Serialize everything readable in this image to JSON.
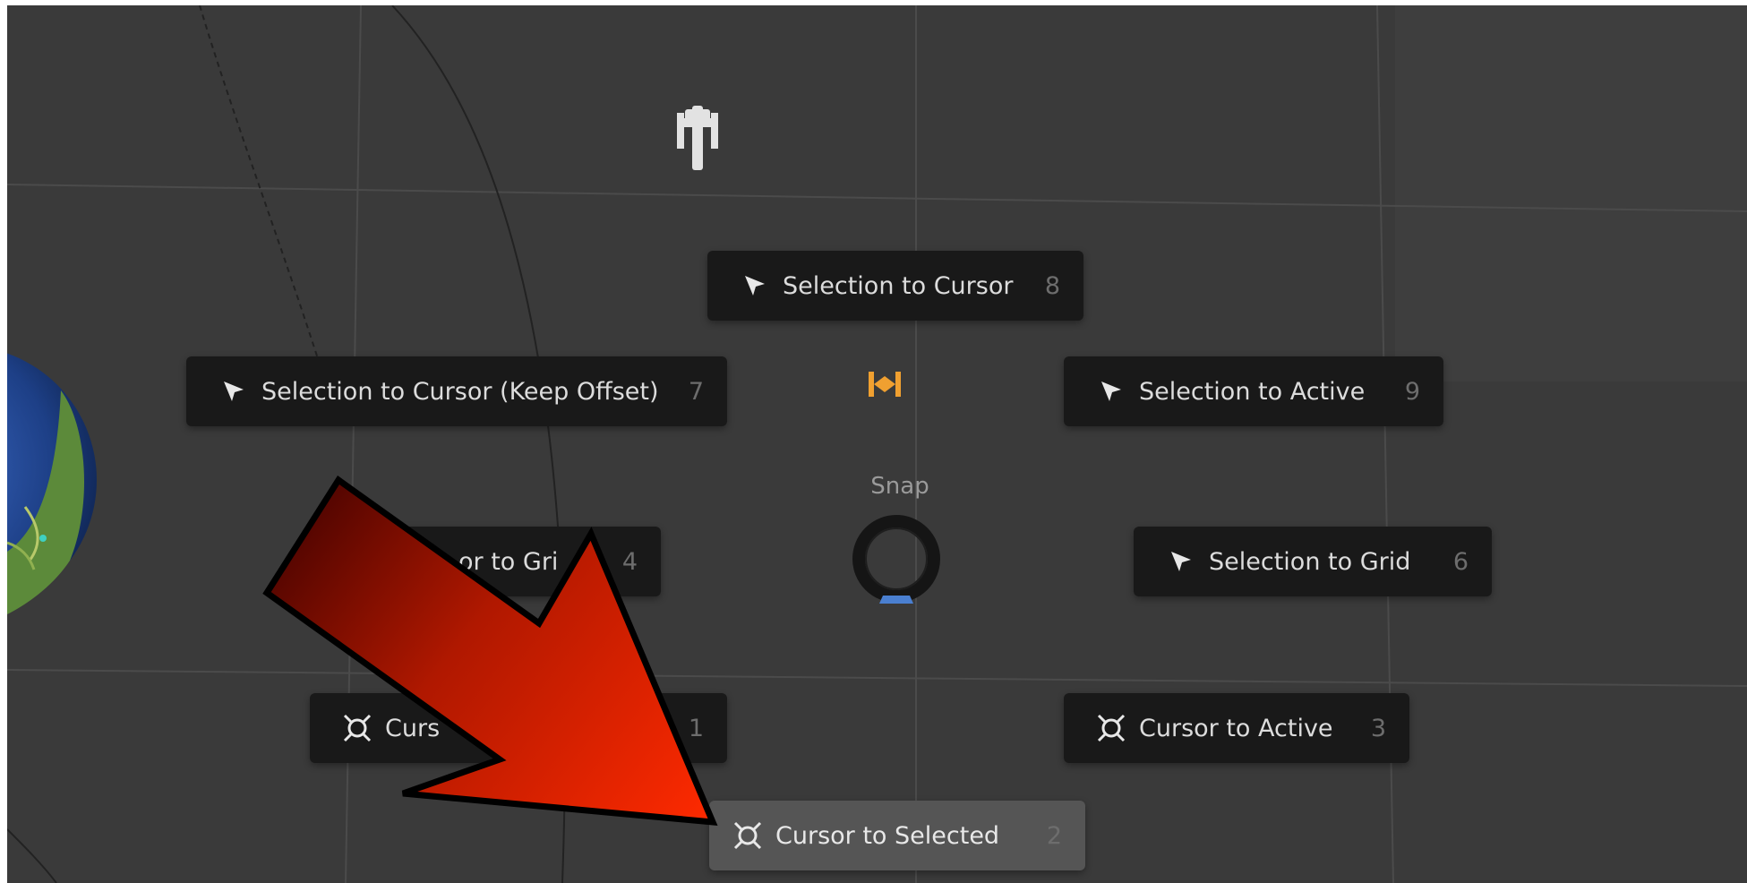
{
  "pie_menu": {
    "title": "Snap",
    "items": [
      {
        "label": "Selection to Cursor",
        "key": "8",
        "icon": "selection-arrow-icon"
      },
      {
        "label": "Selection to Cursor (Keep Offset)",
        "key": "7",
        "icon": "selection-arrow-icon"
      },
      {
        "label": "Selection to Active",
        "key": "9",
        "icon": "selection-arrow-icon"
      },
      {
        "label": "or to Gri",
        "key": "4",
        "icon": "selection-arrow-icon"
      },
      {
        "label": "Selection to Grid",
        "key": "6",
        "icon": "selection-arrow-icon"
      },
      {
        "label": "Curs",
        "key": "1",
        "icon": "cursor-crosshair-icon"
      },
      {
        "label": "Cursor to Active",
        "key": "3",
        "icon": "cursor-crosshair-icon"
      },
      {
        "label": "Cursor to Selected",
        "key": "2",
        "icon": "cursor-crosshair-icon",
        "active": true
      }
    ]
  },
  "colors": {
    "viewport_bg": "#3a3a3a",
    "menu_item_bg": "#191919",
    "menu_item_active_bg": "#555555",
    "snap_accent": "#4a7fd0",
    "snap_icon_orange": "#f0a030",
    "annotation_arrow_dark": "#3a0000",
    "annotation_arrow_bright": "#ff2a00"
  },
  "viewport_objects": {
    "gizmo": "ship-model-icon",
    "snap_icon": "snap-orange-icon",
    "globe": "earth-globe"
  }
}
